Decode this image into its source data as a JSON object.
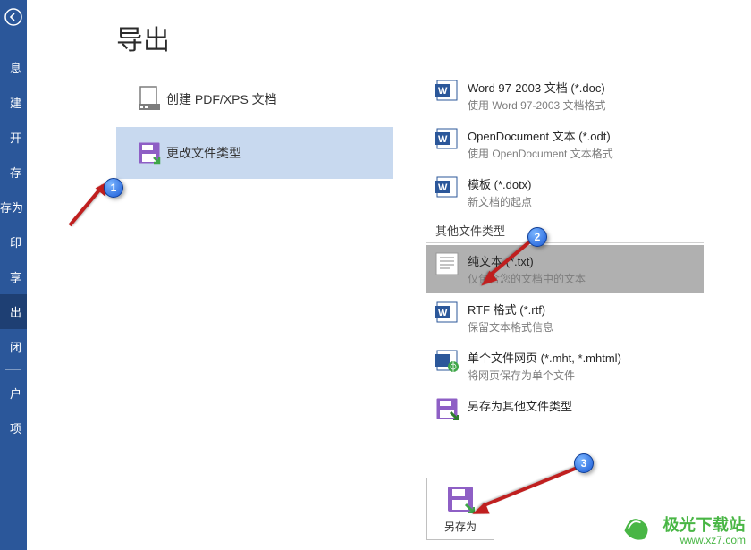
{
  "sidebar": {
    "items": [
      {
        "label": "息"
      },
      {
        "label": "建"
      },
      {
        "label": "开"
      },
      {
        "label": "存"
      },
      {
        "label": "存为"
      },
      {
        "label": "印"
      },
      {
        "label": "享"
      },
      {
        "label": "出",
        "selected": true
      },
      {
        "label": "闭"
      },
      {
        "label": "户"
      },
      {
        "label": "项"
      }
    ]
  },
  "page": {
    "title": "导出"
  },
  "export_options": [
    {
      "label": "创建 PDF/XPS 文档",
      "icon": "pdf"
    },
    {
      "label": "更改文件类型",
      "icon": "save",
      "selected": true
    }
  ],
  "file_types": {
    "pre_section": [
      {
        "title": "Word 97-2003 文档 (*.doc)",
        "desc": "使用 Word 97-2003 文档格式",
        "icon": "docW"
      },
      {
        "title": "OpenDocument 文本 (*.odt)",
        "desc": "使用 OpenDocument 文本格式",
        "icon": "docW"
      },
      {
        "title": "模板 (*.dotx)",
        "desc": "新文档的起点",
        "icon": "docW"
      }
    ],
    "section_label": "其他文件类型",
    "other": [
      {
        "title": "纯文本 (*.txt)",
        "desc": "仅包含您的文档中的文本",
        "icon": "txt",
        "selected": true
      },
      {
        "title": "RTF 格式 (*.rtf)",
        "desc": "保留文本格式信息",
        "icon": "docW"
      },
      {
        "title": "单个文件网页 (*.mht, *.mhtml)",
        "desc": "将网页保存为单个文件",
        "icon": "web"
      },
      {
        "title": "另存为其他文件类型",
        "desc": "",
        "icon": "savep"
      }
    ]
  },
  "save_as": {
    "label": "另存为"
  },
  "callouts": {
    "c1": "1",
    "c2": "2",
    "c3": "3"
  },
  "watermark": {
    "line1": "极光下载站",
    "line2": "www.xz7.com"
  }
}
